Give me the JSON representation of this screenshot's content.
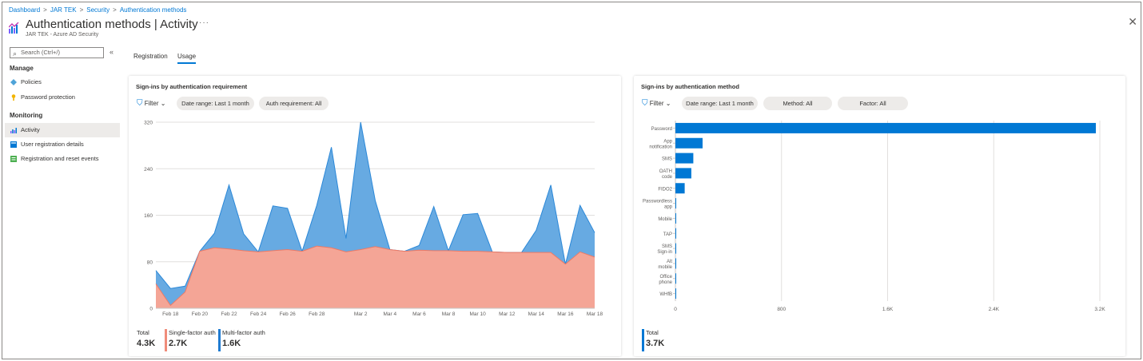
{
  "breadcrumb": [
    "Dashboard",
    "JAR TEK",
    "Security",
    "Authentication methods"
  ],
  "header": {
    "title": "Authentication methods | Activity",
    "subtitle": "JAR TEK - Azure AD Security",
    "more": "···",
    "close": "✕"
  },
  "sidebar": {
    "search_placeholder": "Search (Ctrl+/)",
    "collapse": "«",
    "sections": [
      {
        "heading": "Manage",
        "items": [
          {
            "label": "Policies",
            "icon": "diamond-icon",
            "color": "#4fa3d8"
          },
          {
            "label": "Password protection",
            "icon": "key-icon",
            "color": "#f2b400"
          }
        ]
      },
      {
        "heading": "Monitoring",
        "items": [
          {
            "label": "Activity",
            "icon": "chart-icon",
            "color": "#7b61ff",
            "active": true
          },
          {
            "label": "User registration details",
            "icon": "table-icon",
            "color": "#0078d4"
          },
          {
            "label": "Registration and reset events",
            "icon": "list-icon",
            "color": "#4caf50"
          }
        ]
      }
    ]
  },
  "tabs": [
    {
      "label": "Registration",
      "active": false
    },
    {
      "label": "Usage",
      "active": true
    }
  ],
  "left_card": {
    "title": "Sign-ins by authentication requirement",
    "filter_label": "Filter",
    "pills": [
      "Date range: Last 1 month",
      "Auth requirement: All"
    ],
    "legend": [
      {
        "label": "Total",
        "value": "4.3K",
        "color": ""
      },
      {
        "label": "Single-factor auth",
        "value": "2.7K",
        "color": "#f08c7a"
      },
      {
        "label": "Multi-factor auth",
        "value": "1.6K",
        "color": "#1f7bd1"
      }
    ]
  },
  "right_card": {
    "title": "Sign-ins by authentication method",
    "filter_label": "Filter",
    "pills": [
      "Date range: Last 1 month",
      "Method: All",
      "Factor: All"
    ],
    "legend": [
      {
        "label": "Total",
        "value": "3.7K",
        "color": "#0078d4"
      }
    ]
  },
  "colors": {
    "accent": "#0078d4",
    "single_factor": "#f4a596",
    "multi_factor": "#67aae2",
    "bar": "#0078d4"
  },
  "chart_data": [
    {
      "type": "area",
      "stacked": true,
      "title": "Sign-ins by authentication requirement",
      "x": [
        "Feb 17",
        "Feb 18",
        "Feb 19",
        "Feb 20",
        "Feb 21",
        "Feb 22",
        "Feb 23",
        "Feb 24",
        "Feb 25",
        "Feb 26",
        "Feb 27",
        "Feb 28",
        "Feb 29",
        "Mar 1",
        "Mar 2",
        "Mar 3",
        "Mar 4",
        "Mar 5",
        "Mar 6",
        "Mar 7",
        "Mar 8",
        "Mar 9",
        "Mar 10",
        "Mar 11",
        "Mar 12",
        "Mar 13",
        "Mar 14",
        "Mar 15",
        "Mar 16",
        "Mar 17",
        "Mar 18"
      ],
      "xticks": [
        "Feb 18",
        "Feb 20",
        "Feb 22",
        "Feb 24",
        "Feb 26",
        "Feb 28",
        "Mar 2",
        "Mar 4",
        "Mar 6",
        "Mar 8",
        "Mar 10",
        "Mar 12",
        "Mar 14",
        "Mar 16",
        "Mar 18"
      ],
      "yticks": [
        "0",
        "80",
        "160",
        "240",
        "320"
      ],
      "ylim": [
        0,
        320
      ],
      "series": [
        {
          "name": "Single-factor auth",
          "color": "#f4a596",
          "values": [
            42,
            5,
            28,
            98,
            104,
            102,
            99,
            97,
            99,
            101,
            98,
            107,
            104,
            97,
            101,
            106,
            101,
            98,
            100,
            99,
            99,
            98,
            98,
            97,
            96,
            96,
            96,
            96,
            76,
            97,
            88
          ]
        },
        {
          "name": "Multi-factor auth",
          "color": "#67aae2",
          "values": [
            23,
            29,
            10,
            0,
            25,
            110,
            29,
            0,
            77,
            71,
            0,
            70,
            173,
            23,
            219,
            79,
            0,
            0,
            8,
            76,
            0,
            63,
            65,
            0,
            0,
            0,
            38,
            116,
            0,
            80,
            42
          ]
        }
      ]
    },
    {
      "type": "bar",
      "orientation": "horizontal",
      "title": "Sign-ins by authentication method",
      "categories": [
        "Password",
        "App notification",
        "SMS",
        "OATH code",
        "FIDO2",
        "Passwordless app",
        "Mobile",
        "TAP",
        "SMS Sign-in",
        "Alt mobile",
        "Office phone",
        "WHfB"
      ],
      "values": [
        3170,
        205,
        135,
        120,
        70,
        2,
        2,
        1,
        1,
        1,
        1,
        1
      ],
      "xticks": [
        "0",
        "800",
        "1.6K",
        "2.4K",
        "3.2K"
      ],
      "xlim": [
        0,
        3200
      ]
    }
  ]
}
